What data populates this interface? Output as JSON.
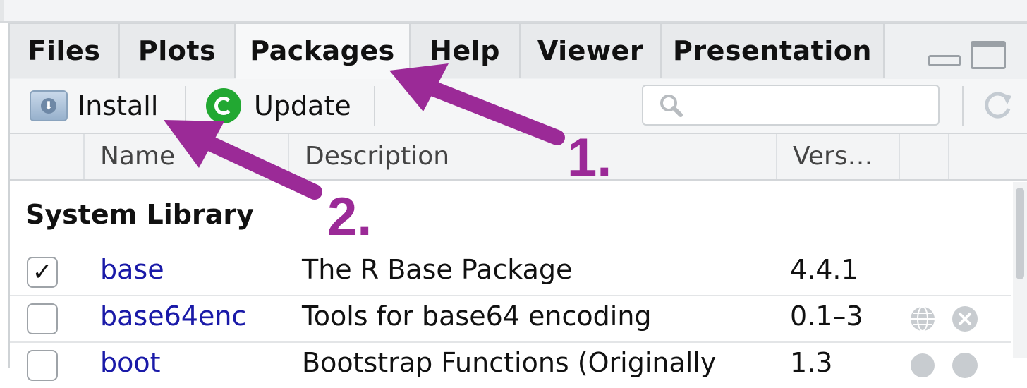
{
  "tabs": [
    {
      "label": "Files"
    },
    {
      "label": "Plots"
    },
    {
      "label": "Packages"
    },
    {
      "label": "Help"
    },
    {
      "label": "Viewer"
    },
    {
      "label": "Presentation"
    }
  ],
  "active_tab": "Packages",
  "toolbar": {
    "install_label": "Install",
    "update_label": "Update",
    "search_value": ""
  },
  "columns": {
    "name": "Name",
    "description": "Description",
    "version": "Vers…"
  },
  "library_heading": "System Library",
  "packages": [
    {
      "checked": true,
      "check_glyph": "✓",
      "name": "base",
      "description": "The R Base Package",
      "version": "4.4.1"
    },
    {
      "checked": false,
      "check_glyph": "",
      "name": "base64enc",
      "description": "Tools for base64 encoding",
      "version": "0.1–3"
    },
    {
      "checked": false,
      "check_glyph": "",
      "name": "boot",
      "description": "Bootstrap Functions (Originally",
      "version": "1.3"
    }
  ],
  "annotations": [
    {
      "label": "1."
    },
    {
      "label": "2."
    }
  ],
  "colors": {
    "annotation": "#9b2a97",
    "package_link": "#1a1aa8",
    "update_green": "#22a832"
  },
  "icons": {
    "install": "install-icon",
    "update": "update-icon",
    "search": "search-icon",
    "refresh": "refresh-icon",
    "website": "globe-icon",
    "remove": "remove-icon"
  }
}
